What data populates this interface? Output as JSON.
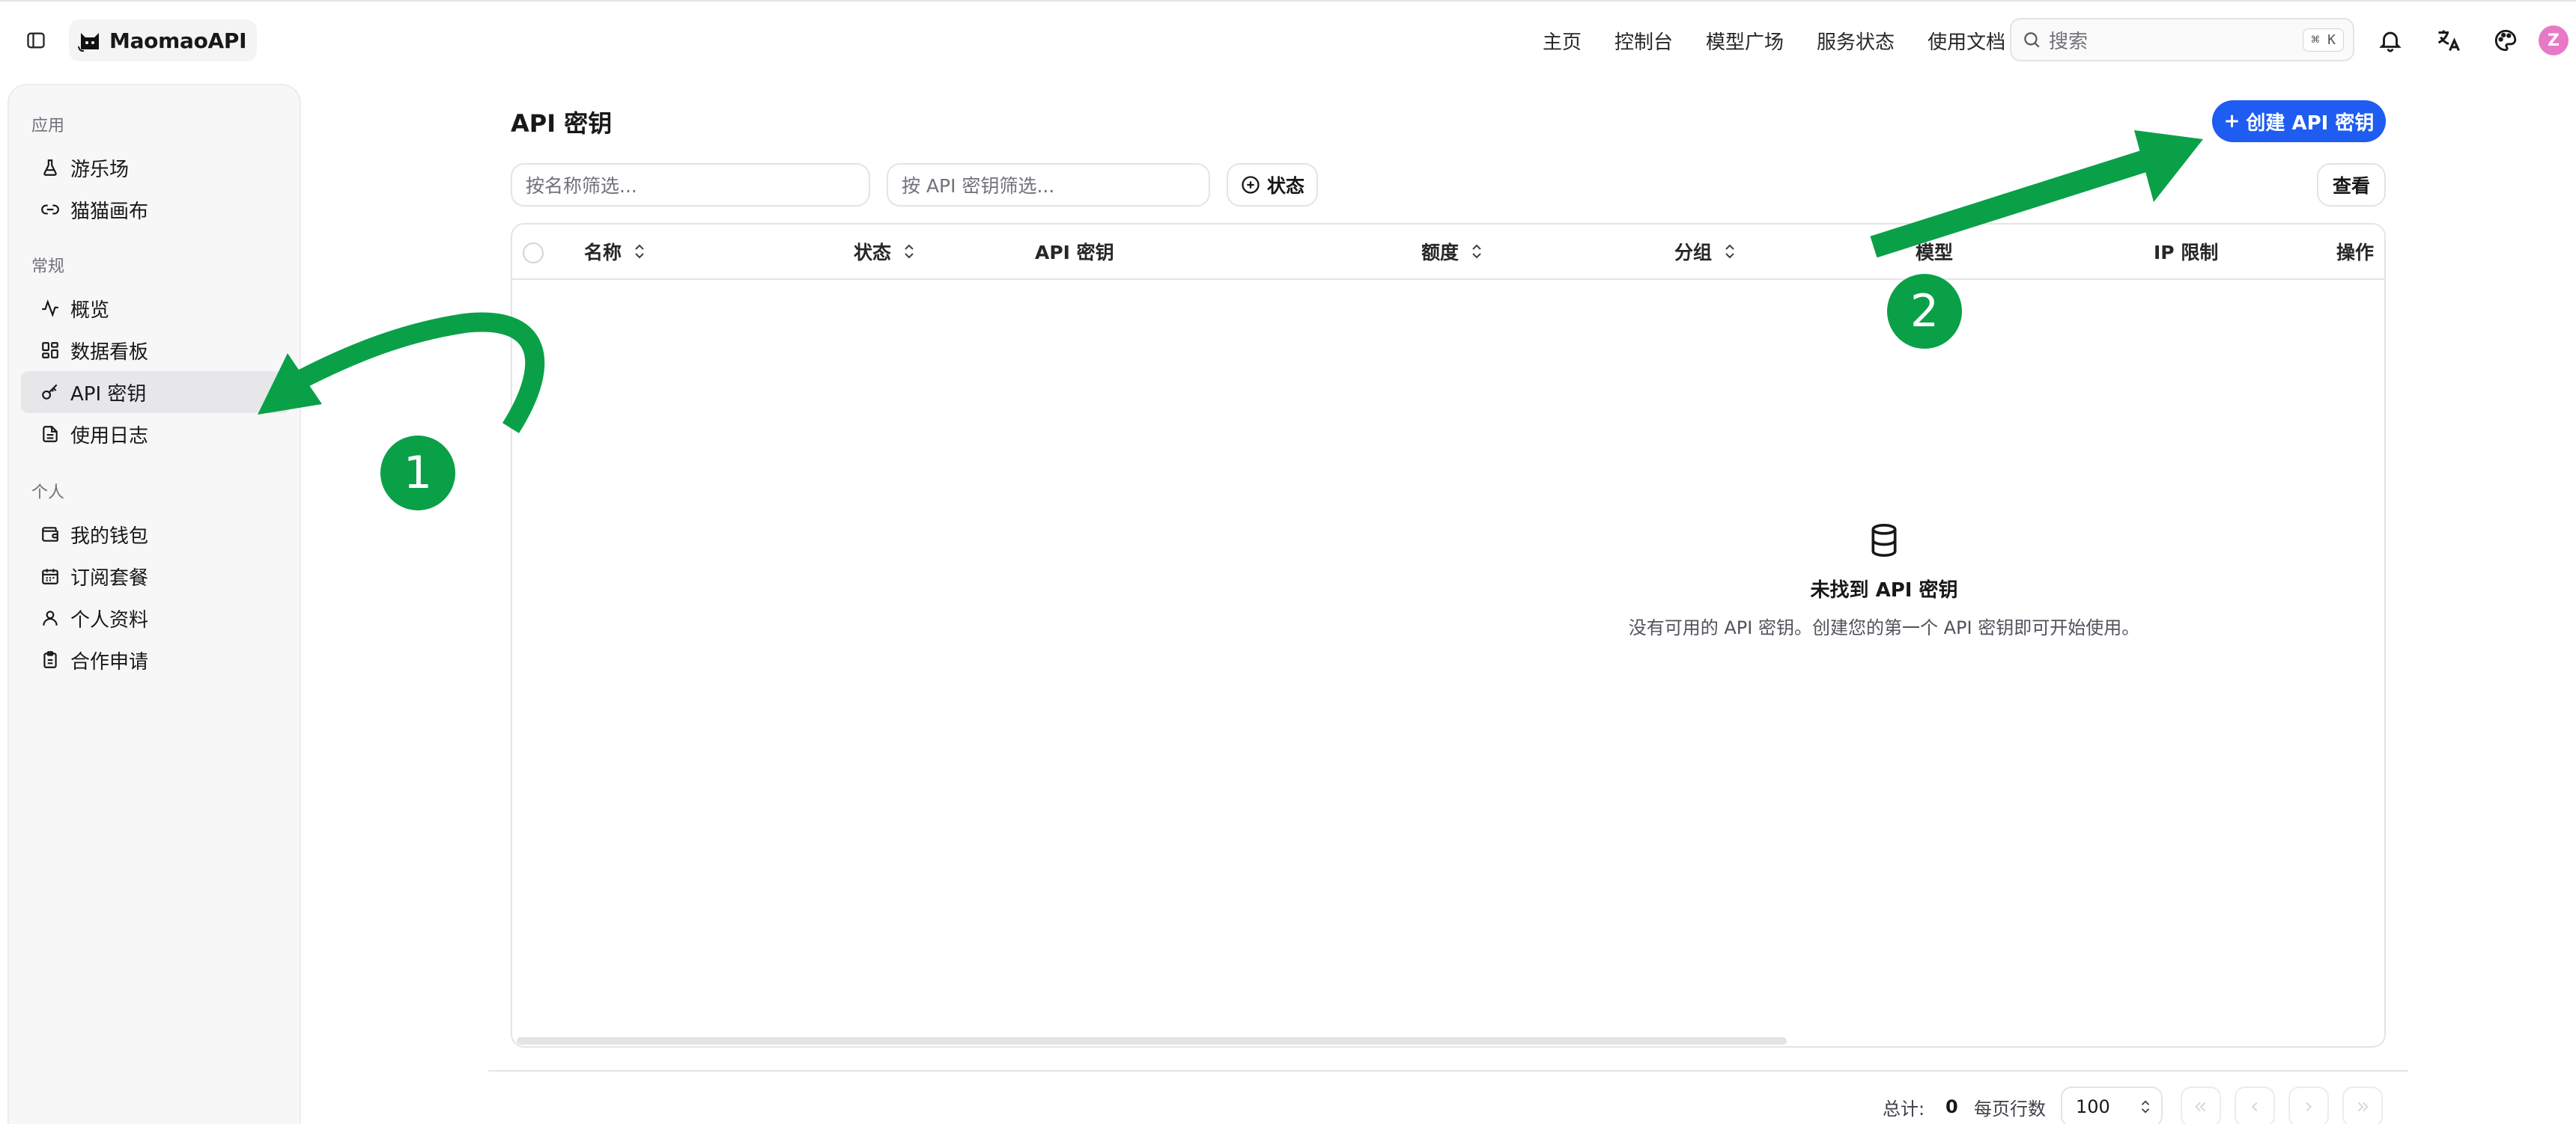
{
  "header": {
    "brand": "MaomaoAPI",
    "nav": [
      "主页",
      "控制台",
      "模型广场",
      "服务状态",
      "使用文档"
    ],
    "search": {
      "placeholder": "搜索",
      "shortcut": "⌘ K"
    },
    "avatar": "Z"
  },
  "sidebar": {
    "sections": [
      {
        "title": "应用",
        "items": [
          {
            "label": "游乐场",
            "icon": "flask-icon"
          },
          {
            "label": "猫猫画布",
            "icon": "link-icon"
          }
        ]
      },
      {
        "title": "常规",
        "items": [
          {
            "label": "概览",
            "icon": "activity-icon"
          },
          {
            "label": "数据看板",
            "icon": "dashboard-icon"
          },
          {
            "label": "API 密钥",
            "icon": "key-icon",
            "active": true
          },
          {
            "label": "使用日志",
            "icon": "file-text-icon"
          }
        ]
      },
      {
        "title": "个人",
        "items": [
          {
            "label": "我的钱包",
            "icon": "wallet-icon"
          },
          {
            "label": "订阅套餐",
            "icon": "calendar-icon"
          },
          {
            "label": "个人资料",
            "icon": "user-icon"
          },
          {
            "label": "合作申请",
            "icon": "clipboard-icon"
          }
        ]
      }
    ]
  },
  "main": {
    "title": "API 密钥",
    "create_label": "创建 API 密钥",
    "create_icon": "+",
    "filters": {
      "name_placeholder": "按名称筛选...",
      "key_placeholder": "按 API 密钥筛选...",
      "status_label": "状态",
      "view_label": "查看"
    },
    "columns": [
      "名称",
      "状态",
      "API 密钥",
      "额度",
      "分组",
      "模型",
      "IP 限制",
      "操作"
    ],
    "empty": {
      "title": "未找到 API 密钥",
      "description": "没有可用的 API 密钥。创建您的第一个 API 密钥即可开始使用。"
    },
    "footer": {
      "total_label": "总计:",
      "total_value": "0",
      "rows_label": "每页行数",
      "rows_value": "100"
    }
  },
  "annotations": {
    "badge_1": "1",
    "badge_2": "2",
    "color": "#0aa048"
  },
  "colors": {
    "primary": "#1e5cf2",
    "annotation": "#0aa048",
    "avatar": "#e879c6"
  }
}
